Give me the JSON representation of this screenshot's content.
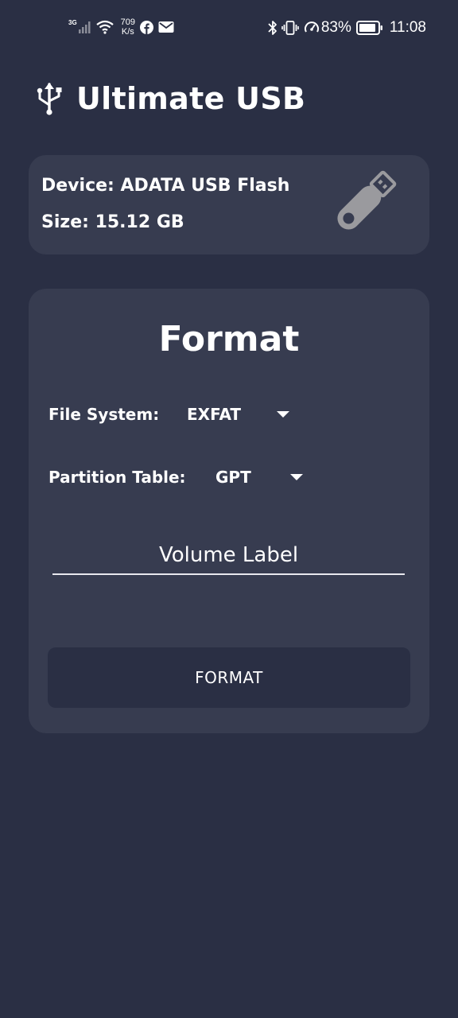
{
  "status_bar": {
    "network_type": "3G",
    "speed_value": "709",
    "speed_unit": "K/s",
    "battery_percent": "83%",
    "time": "11:08"
  },
  "header": {
    "title": "Ultimate USB",
    "icon": "usb-icon"
  },
  "device_card": {
    "device_line": "Device: ADATA USB Flash",
    "size_line": "Size: 15.12 GB",
    "icon": "usb-flash-drive-icon"
  },
  "format_card": {
    "title": "Format",
    "file_system": {
      "label": "File System:",
      "value": "EXFAT"
    },
    "partition_table": {
      "label": "Partition Table:",
      "value": "GPT"
    },
    "volume_label": {
      "placeholder": "Volume Label",
      "value": ""
    },
    "button_label": "FORMAT"
  },
  "colors": {
    "background": "#2a2f44",
    "card": "#373c50",
    "icon_gray": "#9a9a9e",
    "text": "#ffffff"
  }
}
